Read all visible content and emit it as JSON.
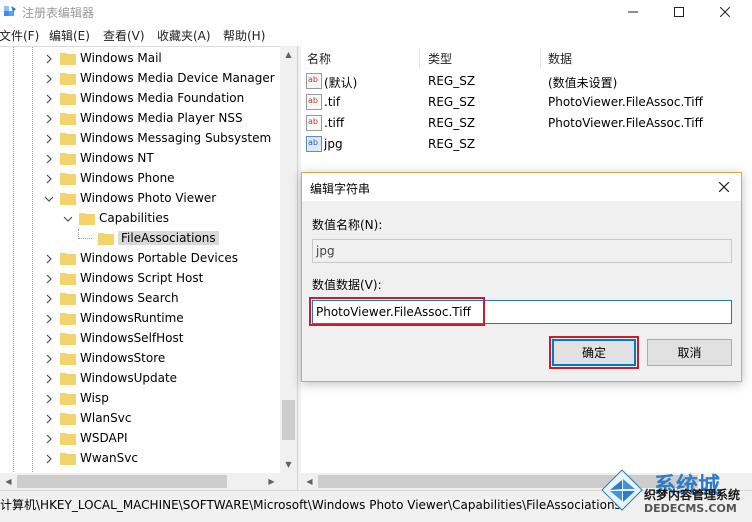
{
  "window": {
    "title": "注册表编辑器",
    "controls": [
      "minimize-icon",
      "maximize-icon",
      "close-icon"
    ]
  },
  "menu": {
    "items": [
      "文件(F)",
      "编辑(E)",
      "查看(V)",
      "收藏夹(A)",
      "帮助(H)"
    ]
  },
  "tree": {
    "items": [
      {
        "label": "Windows Mail",
        "expanded": false
      },
      {
        "label": "Windows Media Device Manager",
        "expanded": false
      },
      {
        "label": "Windows Media Foundation",
        "expanded": false
      },
      {
        "label": "Windows Media Player NSS",
        "expanded": false
      },
      {
        "label": "Windows Messaging Subsystem",
        "expanded": false
      },
      {
        "label": "Windows NT",
        "expanded": false
      },
      {
        "label": "Windows Phone",
        "expanded": false
      },
      {
        "label": "Windows Photo Viewer",
        "expanded": true
      },
      {
        "label": "Capabilities",
        "expanded": true
      },
      {
        "label": "FileAssociations",
        "selected": true
      },
      {
        "label": "Windows Portable Devices",
        "expanded": false
      },
      {
        "label": "Windows Script Host",
        "expanded": false
      },
      {
        "label": "Windows Search",
        "expanded": false
      },
      {
        "label": "WindowsRuntime",
        "expanded": false
      },
      {
        "label": "WindowsSelfHost",
        "expanded": false
      },
      {
        "label": "WindowsStore",
        "expanded": false
      },
      {
        "label": "WindowsUpdate",
        "expanded": false
      },
      {
        "label": "Wisp",
        "expanded": false
      },
      {
        "label": "WlanSvc",
        "expanded": false
      },
      {
        "label": "WSDAPI",
        "expanded": false
      },
      {
        "label": "WwanSvc",
        "expanded": false
      }
    ]
  },
  "list": {
    "columns": [
      "名称",
      "类型",
      "数据"
    ],
    "rows": [
      {
        "icon": "string-value-icon",
        "name": "(默认)",
        "type": "REG_SZ",
        "data": "(数值未设置)"
      },
      {
        "icon": "string-value-icon",
        "name": ".tif",
        "type": "REG_SZ",
        "data": "PhotoViewer.FileAssoc.Tiff"
      },
      {
        "icon": "string-value-icon",
        "name": ".tiff",
        "type": "REG_SZ",
        "data": "PhotoViewer.FileAssoc.Tiff"
      },
      {
        "icon": "string-value-icon",
        "name": "jpg",
        "type": "REG_SZ",
        "data": ""
      }
    ]
  },
  "dialog": {
    "title": "编辑字符串",
    "name_label": "数值名称(N):",
    "name_value": "jpg",
    "data_label": "数值数据(V):",
    "data_value": "PhotoViewer.FileAssoc.Tiff",
    "ok_label": "确定",
    "cancel_label": "取消",
    "highlight_color": "#c81e2c",
    "focus_color": "#0078d7"
  },
  "statusbar": {
    "path": "计算机\\HKEY_LOCAL_MACHINE\\SOFTWARE\\Microsoft\\Windows Photo Viewer\\Capabilities\\FileAssociations"
  },
  "watermark": {
    "line1": "系统城",
    "line2": "织梦内容管理系统",
    "line3": "DEDECMS.COM"
  },
  "colors": {
    "folder": "#f5d36c",
    "accent": "#2a7dc6"
  }
}
